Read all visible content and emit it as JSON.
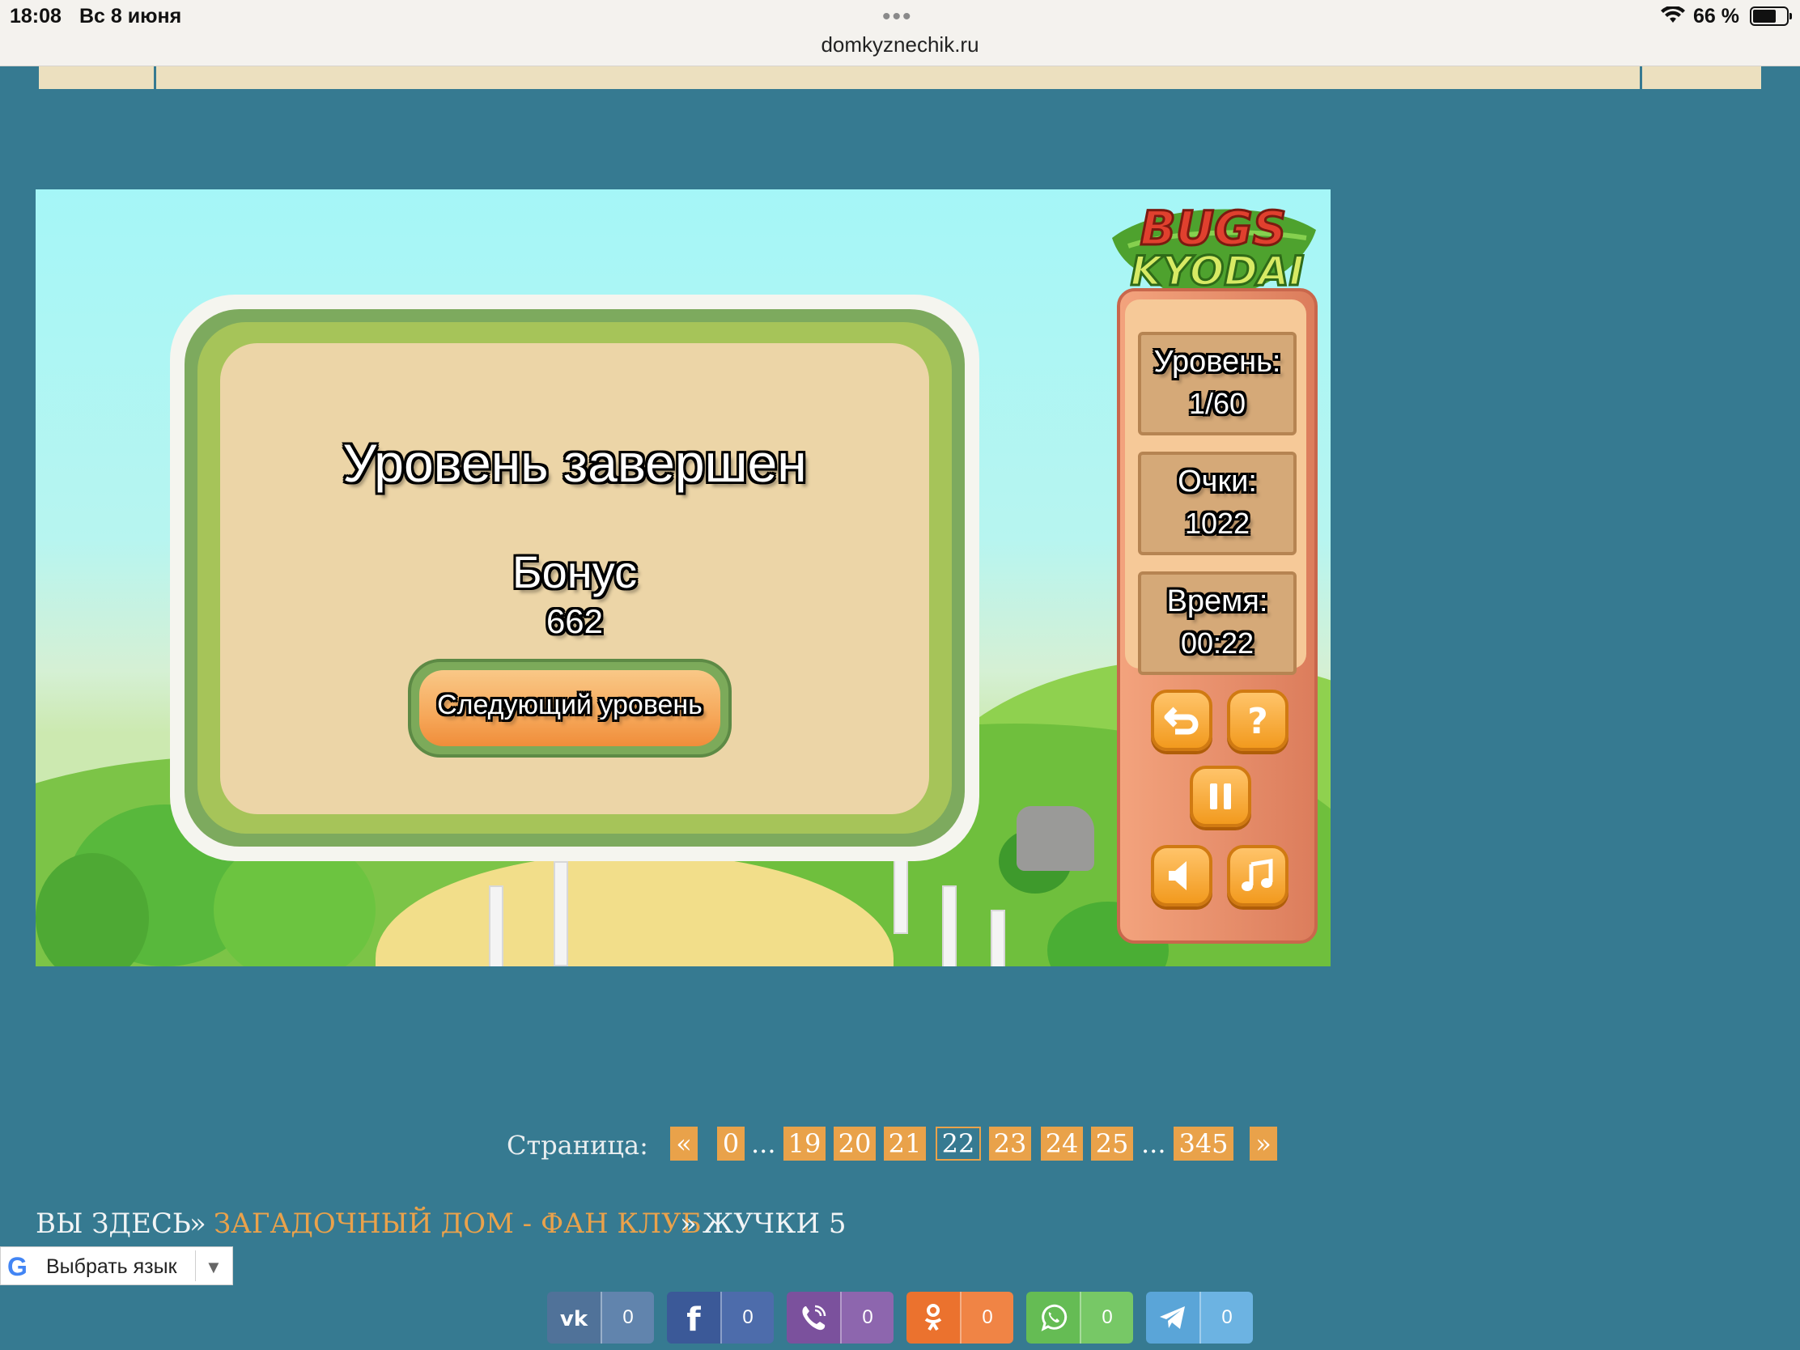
{
  "status_bar": {
    "time": "18:08",
    "date": "Вс 8 июня",
    "url": "domkyznechik.ru",
    "battery": "66 %",
    "icons": [
      "wifi-icon",
      "battery-icon"
    ]
  },
  "game": {
    "logo_text_top": "BUGS",
    "logo_text_bottom": "KYODAI",
    "dialog": {
      "title": "Уровень завершен",
      "bonus_label": "Бонус",
      "bonus_value": "662",
      "next_button": "Следующий уровень"
    },
    "stats": {
      "level_label": "Уровень:",
      "level_value": "1/60",
      "score_label": "Очки:",
      "score_value": "1022",
      "time_label": "Время:",
      "time_value": "00:22"
    },
    "controls": [
      "undo-icon",
      "help-icon",
      "pause-icon",
      "sound-icon",
      "music-icon"
    ]
  },
  "pager": {
    "label": "Страница:",
    "prev": "«",
    "next": "»",
    "first": "0",
    "pages": [
      "19",
      "20",
      "21",
      "22",
      "23",
      "24",
      "25"
    ],
    "current": "22",
    "last": "345",
    "ellipsis": "..."
  },
  "breadcrumb": {
    "home": "ВЫ ЗДЕСЬ",
    "sep": "»",
    "section": "ЗАГАДОЧНЫЙ ДОМ - ФАН КЛУБ",
    "current": "ЖУЧКИ 5"
  },
  "translate": {
    "label": "Выбрать язык",
    "logo": "G",
    "arrow": "▼"
  },
  "share": [
    {
      "network": "vk",
      "count": "0",
      "color": "#507299"
    },
    {
      "network": "facebook",
      "count": "0",
      "color": "#3b5998"
    },
    {
      "network": "viber",
      "count": "0",
      "color": "#7b519d"
    },
    {
      "network": "odnoklassniki",
      "count": "0",
      "color": "#eb722e"
    },
    {
      "network": "whatsapp",
      "count": "0",
      "color": "#65bc54"
    },
    {
      "network": "telegram",
      "count": "0",
      "color": "#5aa5d8"
    }
  ]
}
